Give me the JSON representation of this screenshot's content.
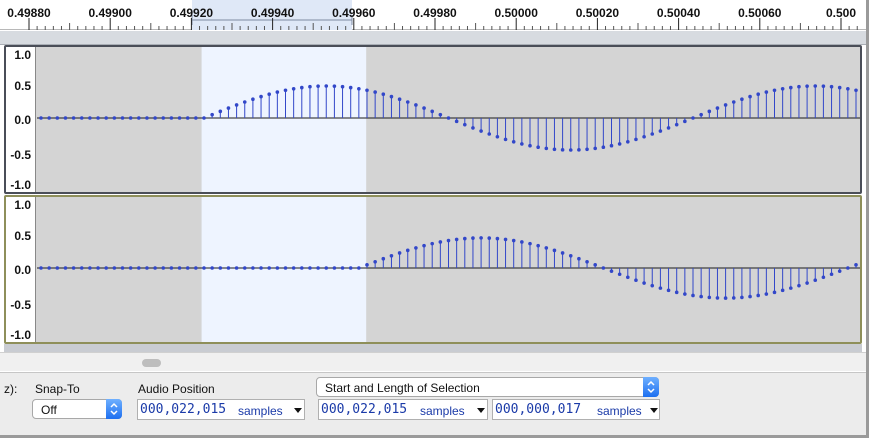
{
  "ruler": {
    "ticks": [
      "0.49880",
      "0.49900",
      "0.49920",
      "0.49940",
      "0.49960",
      "0.49980",
      "0.50000",
      "0.50020",
      "0.50040",
      "0.50060",
      "0.500"
    ]
  },
  "tracks": [
    {
      "scale_labels": [
        "1.0",
        "0.5",
        "0.0",
        "-0.5",
        "-1.0"
      ],
      "waveform": {
        "silent_until_sample": 20,
        "amplitude": 0.5,
        "period_samples": 60,
        "sample_count": 101
      }
    },
    {
      "scale_labels": [
        "1.0",
        "0.5",
        "0.0",
        "-0.5",
        "-1.0"
      ],
      "waveform": {
        "silent_until_sample": 39,
        "amplitude": 0.47,
        "period_samples": 60,
        "sample_count": 101
      }
    }
  ],
  "selection": {
    "start_time": 0.4992,
    "end_time": 0.4996
  },
  "view": {
    "start_time": 0.4988,
    "end_time": 0.5008
  },
  "toolbar": {
    "rate_label": "z):",
    "snap_label": "Snap-To",
    "snap_value": "Off",
    "audio_position_label": "Audio Position",
    "selection_mode": "Start and Length of Selection",
    "audio_position": {
      "value": "000,022,015",
      "unit": "samples"
    },
    "selection_start": {
      "value": "000,022,015",
      "unit": "samples"
    },
    "selection_length": {
      "value": "000,000,017",
      "unit": "samples"
    }
  },
  "colors": {
    "selection": "#eef4ff",
    "unselected": "#d4d4d4",
    "waveform": "#3247c9"
  }
}
